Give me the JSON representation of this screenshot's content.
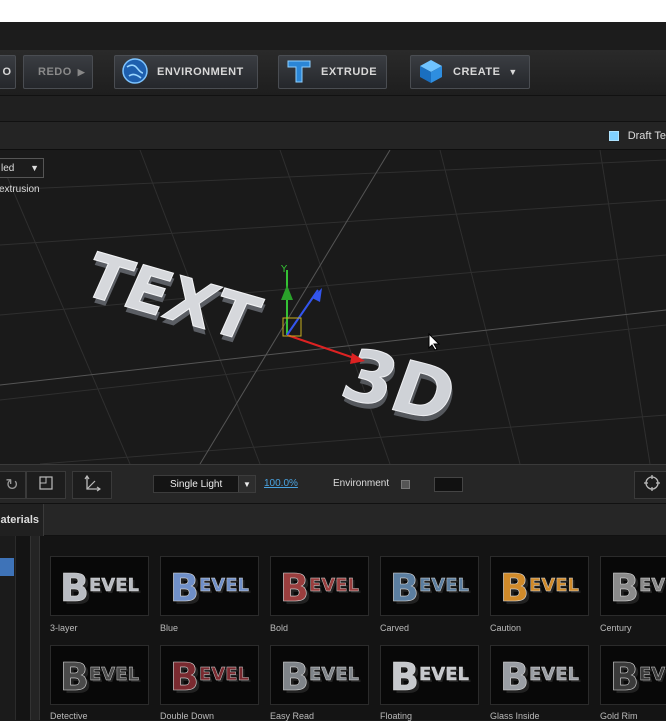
{
  "toolbar": {
    "undo_label": "O",
    "redo_label": "REDO",
    "environment_label": "ENVIRONMENT",
    "extrude_label": "EXTRUDE",
    "create_label": "CREATE"
  },
  "viewport": {
    "draft_label": "Draft Te",
    "mode_value": "led",
    "extrusion_label": "extrusion",
    "text_line1": "TEXT",
    "text_line2": "3D"
  },
  "bottombar": {
    "light_value": "Single Light",
    "zoom_value": "100.0%",
    "environment_label": "Environment"
  },
  "materials": {
    "tab_label": "aterials",
    "items": [
      {
        "label": "3-layer",
        "color": "#b9bcc2"
      },
      {
        "label": "Blue",
        "color": "#6f8fc8"
      },
      {
        "label": "Bold",
        "color": "#9a3e3e"
      },
      {
        "label": "Carved",
        "color": "#5b7ea0"
      },
      {
        "label": "Caution",
        "color": "#d08a2a"
      },
      {
        "label": "Century",
        "color": "#8a8a8a"
      },
      {
        "label": "Detective",
        "color": "#4a4a4a"
      },
      {
        "label": "Double Down",
        "color": "#7a2a30"
      },
      {
        "label": "Easy Read",
        "color": "#7f8489"
      },
      {
        "label": "Floating",
        "color": "#c6c8cc"
      },
      {
        "label": "Glass Inside",
        "color": "#9a9ea4"
      },
      {
        "label": "Gold Rim",
        "color": "#3a3a3a"
      }
    ]
  }
}
